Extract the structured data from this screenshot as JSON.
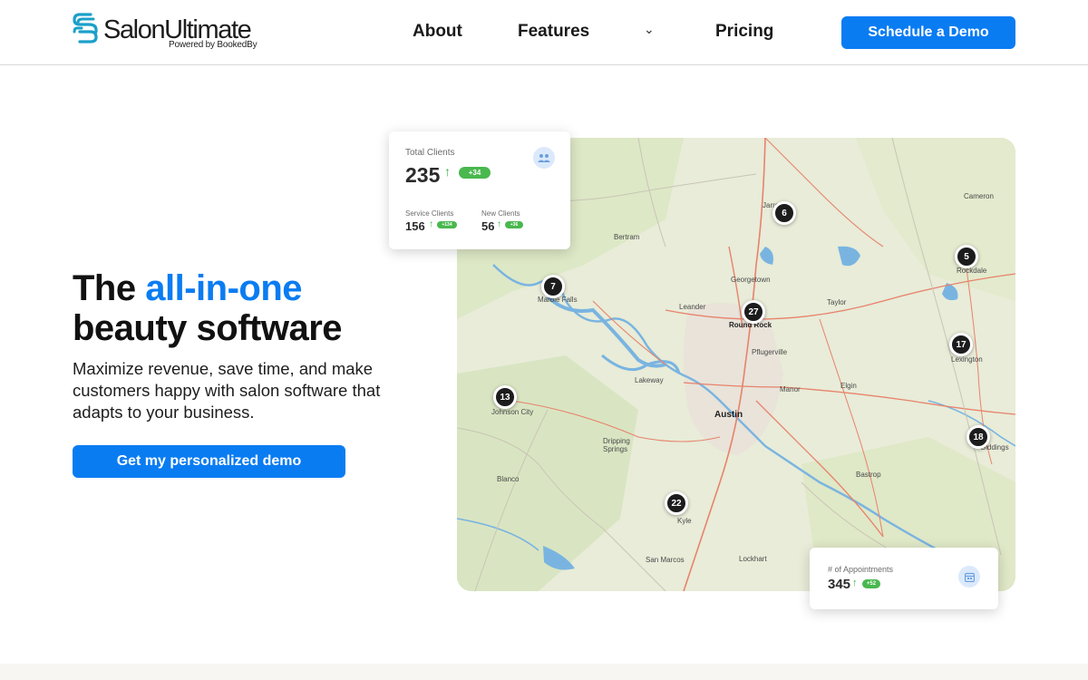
{
  "header": {
    "logo_name": "SalonUltimate",
    "logo_sub": "Powered by BookedBy",
    "nav": {
      "about": "About",
      "features": "Features",
      "chevron": "⌄",
      "pricing": "Pricing"
    },
    "cta": "Schedule a Demo"
  },
  "hero": {
    "title_1": "The ",
    "title_accent": "all-in-one",
    "title_2": "beauty software",
    "subtitle": "Maximize revenue, save time, and make customers happy with salon software that adapts to your business.",
    "cta": "Get my personalized demo"
  },
  "map": {
    "places": {
      "jarrell": "Jarrell",
      "cameron": "Cameron",
      "bertram": "Bertram",
      "marble_falls": "Marble Falls",
      "georgetown": "Georgetown",
      "leander": "Leander",
      "round_rock": "Round Rock",
      "taylor": "Taylor",
      "rockdale": "Rockdale",
      "pflugerville": "Pflugerville",
      "lexington": "Lexington",
      "lakeway": "Lakeway",
      "manor": "Manor",
      "elgin": "Elgin",
      "johnson_city": "Johnson City",
      "austin": "Austin",
      "dripping_springs": "Dripping Springs",
      "giddings": "Giddings",
      "blanco": "Blanco",
      "bastrop": "Bastrop",
      "kyle": "Kyle",
      "san_marcos": "San Marcos",
      "lockhart": "Lockhart"
    },
    "pins": {
      "jarrell": "6",
      "rockdale": "5",
      "marble_falls": "7",
      "round_rock": "27",
      "lexington": "17",
      "johnson_city": "13",
      "giddings": "18",
      "kyle": "22"
    }
  },
  "card_clients": {
    "title": "Total Clients",
    "total": "235",
    "arrow": "↑",
    "total_delta": "+34",
    "service_label": "Service Clients",
    "service_value": "156",
    "service_delta": "+134",
    "new_label": "New Clients",
    "new_value": "56",
    "new_delta": "+36",
    "icon": "users-icon"
  },
  "card_appointments": {
    "title": "# of Appointments",
    "value": "345",
    "arrow": "↑",
    "delta": "+52",
    "icon": "calendar-icon"
  },
  "colors": {
    "brand_blue": "#0a7cf2",
    "logo_teal": "#1ba0c9",
    "positive_green": "#49b84e",
    "pin_dark": "#1c1c1c"
  }
}
